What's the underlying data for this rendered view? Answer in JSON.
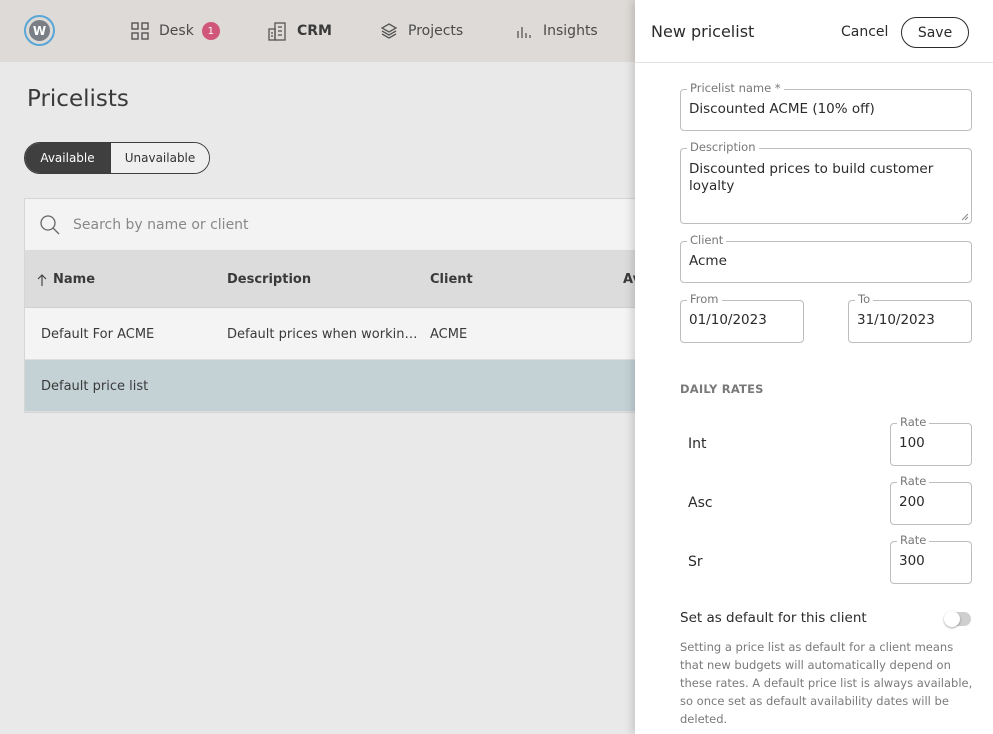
{
  "nav": {
    "items": [
      {
        "label": "Desk",
        "icon": "grid-icon",
        "badge": "1"
      },
      {
        "label": "CRM",
        "icon": "building-icon"
      },
      {
        "label": "Projects",
        "icon": "layers-icon"
      },
      {
        "label": "Insights",
        "icon": "bar-chart-icon"
      }
    ]
  },
  "main": {
    "title": "Pricelists",
    "segments": {
      "available": "Available",
      "unavailable": "Unavailable"
    },
    "search_placeholder": "Search by name or client",
    "columns": {
      "name": "Name",
      "description": "Description",
      "client": "Client",
      "avail": "Av"
    },
    "rows": [
      {
        "name": "Default For ACME",
        "description": "Default prices when workin…",
        "client": "ACME"
      },
      {
        "name": "Default price list",
        "description": "",
        "client": ""
      }
    ]
  },
  "panel": {
    "title": "New pricelist",
    "cancel": "Cancel",
    "save": "Save",
    "name_label": "Pricelist name *",
    "name_value": "Discounted ACME (10% off)",
    "desc_label": "Description",
    "desc_value": "Discounted prices to build customer loyalty",
    "client_label": "Client",
    "client_value": "Acme",
    "from_label": "From",
    "from_value": "01/10/2023",
    "to_label": "To",
    "to_value": "31/10/2023",
    "daily_rates_title": "DAILY RATES",
    "rates": [
      {
        "level": "Int",
        "label": "Rate",
        "value": "100"
      },
      {
        "level": "Asc",
        "label": "Rate",
        "value": "200"
      },
      {
        "level": "Sr",
        "label": "Rate",
        "value": "300"
      }
    ],
    "default_toggle_label": "Set as default for this client",
    "default_toggle_on": false,
    "hint": "Setting a price list as default for a client means that new budgets will automatically depend on these rates. A default price list is always available, so once set as default availability dates will be deleted."
  },
  "colors": {
    "accent_dark": "#3f3f3f",
    "badge": "#d0577a",
    "selected_row": "#c4d2d6",
    "logo_ring": "#5aa6d6"
  }
}
